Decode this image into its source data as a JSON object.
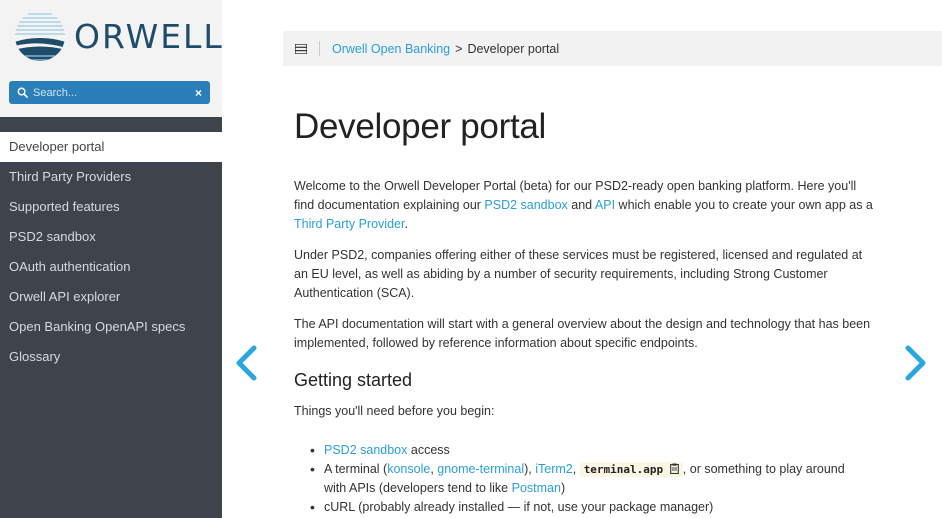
{
  "brand": {
    "name": "ORWELL",
    "accent": "#2a7fb8",
    "link_color": "#2a9fd6",
    "sidebar_bg": "#3f444c"
  },
  "search": {
    "placeholder": "Search...",
    "clear_icon": "×"
  },
  "sidebar": {
    "items": [
      {
        "label": "Developer portal",
        "active": true
      },
      {
        "label": "Third Party Providers"
      },
      {
        "label": "Supported features"
      },
      {
        "label": "PSD2 sandbox"
      },
      {
        "label": "OAuth authentication"
      },
      {
        "label": "Orwell API explorer"
      },
      {
        "label": "Open Banking OpenAPI specs"
      },
      {
        "label": "Glossary"
      }
    ]
  },
  "breadcrumb": {
    "link": "Orwell Open Banking",
    "separator": ">",
    "current": "Developer portal"
  },
  "main": {
    "title": "Developer portal",
    "p1": {
      "t1": "Welcome to the Orwell Developer Portal (beta) for our PSD2-ready open banking platform. Here you'll find documentation explaining our ",
      "link1": "PSD2 sandbox",
      "t2": " and ",
      "link2": "API",
      "t3": " which enable you to create your own app as a ",
      "link3": "Third Party Provider",
      "t4": "."
    },
    "p2": "Under PSD2, companies offering either of these services must be registered, licensed and regulated at an EU level, as well as abiding by a number of security requirements, including Strong Customer Authentication (SCA).",
    "p3": "The API documentation will start with a general overview about the design and technology that has been implemented, followed by reference information about specific endpoints.",
    "getting_started": {
      "heading": "Getting started",
      "intro": "Things you'll need before you begin:",
      "item1": {
        "link": "PSD2 sandbox",
        "text": " access"
      },
      "item2": {
        "t1": "A terminal (",
        "link1": "konsole",
        "t2": ", ",
        "link2": "gnome-terminal",
        "t3": "), ",
        "link3": "iTerm2",
        "t4": ", ",
        "code": "terminal.app",
        "t5": ", or something to play around with APIs (developers tend to like ",
        "link4": "Postman",
        "t6": ")"
      },
      "item3": "cURL (probably already installed — if not, use your package manager)"
    }
  },
  "icons": {
    "prev": "chevron-left-icon",
    "next": "chevron-right-icon",
    "menu": "menu-icon",
    "search": "search-icon",
    "clipboard": "clipboard-icon"
  }
}
